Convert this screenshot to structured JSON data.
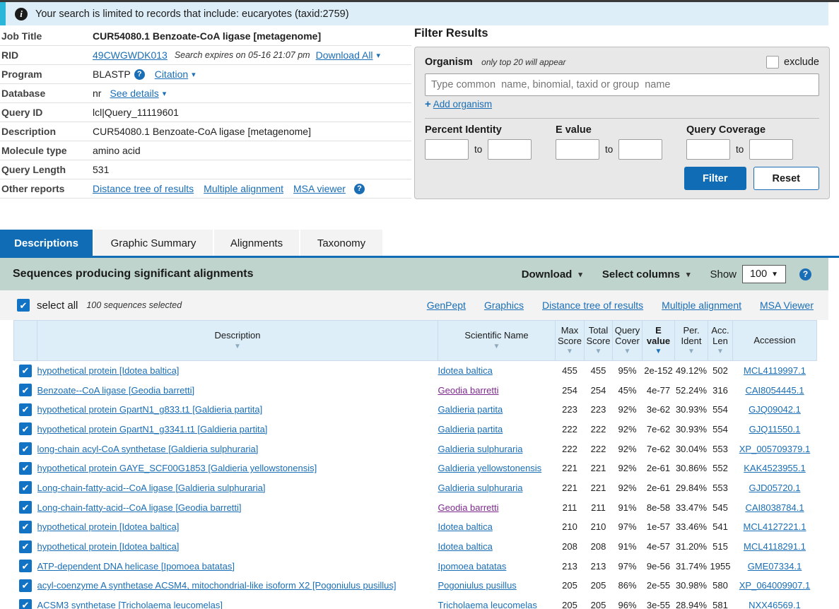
{
  "banner": {
    "icon": "info-icon",
    "text": "Your search is limited to records that include: eucaryotes (taxid:2759)"
  },
  "job_info": {
    "rows": [
      {
        "label": "Job Title",
        "value": "CUR54080.1 Benzoate-CoA ligase [metagenome]"
      },
      {
        "label": "RID",
        "link": "49CWGWDK013",
        "expires": "Search expires on 05-16 21:07 pm",
        "download_all": "Download All"
      },
      {
        "label": "Program",
        "value": "BLASTP",
        "citation": "Citation"
      },
      {
        "label": "Database",
        "value": "nr",
        "see_details": "See details"
      },
      {
        "label": "Query ID",
        "value": "lcl|Query_11119601"
      },
      {
        "label": "Description",
        "value": "CUR54080.1 Benzoate-CoA ligase [metagenome]"
      },
      {
        "label": "Molecule type",
        "value": "amino acid"
      },
      {
        "label": "Query Length",
        "value": "531"
      },
      {
        "label": "Other reports",
        "links": [
          "Distance tree of results",
          "Multiple alignment",
          "MSA viewer"
        ]
      }
    ]
  },
  "filter": {
    "title": "Filter Results",
    "organism_label": "Organism",
    "organism_hint": "only top 20 will appear",
    "exclude_label": "exclude",
    "organism_placeholder": "Type common  name, binomial, taxid or group  name",
    "organism_value": "",
    "add_organism": "Add organism",
    "percent_identity_label": "Percent Identity",
    "evalue_label": "E value",
    "query_coverage_label": "Query Coverage",
    "to_label": "to",
    "pid_from": "",
    "pid_to": "",
    "ev_from": "",
    "ev_to": "",
    "qc_from": "",
    "qc_to": "",
    "filter_button": "Filter",
    "reset_button": "Reset"
  },
  "tabs": [
    {
      "label": "Descriptions",
      "active": true
    },
    {
      "label": "Graphic Summary",
      "active": false
    },
    {
      "label": "Alignments",
      "active": false
    },
    {
      "label": "Taxonomy",
      "active": false
    }
  ],
  "results_band": {
    "title": "Sequences producing significant alignments",
    "download": "Download",
    "select_columns": "Select columns",
    "show_label": "Show",
    "show_value": "100",
    "help": "?"
  },
  "select_all": {
    "label": "select all",
    "count": "100 sequences selected",
    "links": [
      "GenPept",
      "Graphics",
      "Distance tree of results",
      "Multiple alignment",
      "MSA Viewer"
    ]
  },
  "table": {
    "columns": [
      {
        "key": "check",
        "label": ""
      },
      {
        "key": "description",
        "label": "Description",
        "sorted": false
      },
      {
        "key": "scientific_name",
        "label": "Scientific Name",
        "sorted": false
      },
      {
        "key": "max_score",
        "label": "Max\nScore",
        "line1": "Max",
        "line2": "Score",
        "sorted": false
      },
      {
        "key": "total_score",
        "label": "Total Score",
        "line1": "Total",
        "line2": "Score",
        "sorted": false
      },
      {
        "key": "query_cover",
        "label": "Query Cover",
        "line1": "Query",
        "line2": "Cover",
        "sorted": false
      },
      {
        "key": "e_value",
        "label": "E value",
        "line1": "E",
        "line2": "value",
        "sorted": true
      },
      {
        "key": "per_ident",
        "label": "Per. Ident",
        "line1": "Per.",
        "line2": "Ident",
        "sorted": false
      },
      {
        "key": "acc_len",
        "label": "Acc. Len",
        "line1": "Acc.",
        "line2": "Len",
        "sorted": false
      },
      {
        "key": "accession",
        "label": "Accession",
        "sorted": false
      }
    ],
    "rows": [
      {
        "checked": true,
        "description": "hypothetical protein [Idotea baltica]",
        "scientific_name": "Idotea baltica",
        "sci_visited": false,
        "max_score": "455",
        "total_score": "455",
        "query_cover": "95%",
        "e_value": "2e-152",
        "per_ident": "49.12%",
        "acc_len": "502",
        "accession": "MCL4119997.1"
      },
      {
        "checked": true,
        "description": "Benzoate--CoA ligase [Geodia barretti]",
        "scientific_name": "Geodia barretti",
        "sci_visited": true,
        "max_score": "254",
        "total_score": "254",
        "query_cover": "45%",
        "e_value": "4e-77",
        "per_ident": "52.24%",
        "acc_len": "316",
        "accession": "CAI8054445.1"
      },
      {
        "checked": true,
        "description": "hypothetical protein GpartN1_g833.t1 [Galdieria partita]",
        "scientific_name": "Galdieria partita",
        "sci_visited": false,
        "max_score": "223",
        "total_score": "223",
        "query_cover": "92%",
        "e_value": "3e-62",
        "per_ident": "30.93%",
        "acc_len": "554",
        "accession": "GJQ09042.1"
      },
      {
        "checked": true,
        "description": "hypothetical protein GpartN1_g3341.t1 [Galdieria partita]",
        "scientific_name": "Galdieria partita",
        "sci_visited": false,
        "max_score": "222",
        "total_score": "222",
        "query_cover": "92%",
        "e_value": "7e-62",
        "per_ident": "30.93%",
        "acc_len": "554",
        "accession": "GJQ11550.1"
      },
      {
        "checked": true,
        "description": "long-chain acyl-CoA synthetase [Galdieria sulphuraria]",
        "scientific_name": "Galdieria sulphuraria",
        "sci_visited": false,
        "max_score": "222",
        "total_score": "222",
        "query_cover": "92%",
        "e_value": "7e-62",
        "per_ident": "30.04%",
        "acc_len": "553",
        "accession": "XP_005709379.1"
      },
      {
        "checked": true,
        "description": "hypothetical protein GAYE_SCF00G1853 [Galdieria yellowstonensis]",
        "scientific_name": "Galdieria yellowstonensis",
        "sci_visited": false,
        "max_score": "221",
        "total_score": "221",
        "query_cover": "92%",
        "e_value": "2e-61",
        "per_ident": "30.86%",
        "acc_len": "552",
        "accession": "KAK4523955.1"
      },
      {
        "checked": true,
        "description": "Long-chain-fatty-acid--CoA ligase [Galdieria sulphuraria]",
        "scientific_name": "Galdieria sulphuraria",
        "sci_visited": false,
        "max_score": "221",
        "total_score": "221",
        "query_cover": "92%",
        "e_value": "2e-61",
        "per_ident": "29.84%",
        "acc_len": "553",
        "accession": "GJD05720.1"
      },
      {
        "checked": true,
        "description": "Long-chain-fatty-acid--CoA ligase [Geodia barretti]",
        "scientific_name": "Geodia barretti",
        "sci_visited": true,
        "max_score": "211",
        "total_score": "211",
        "query_cover": "91%",
        "e_value": "8e-58",
        "per_ident": "33.47%",
        "acc_len": "545",
        "accession": "CAI8038784.1"
      },
      {
        "checked": true,
        "description": "hypothetical protein [Idotea baltica]",
        "scientific_name": "Idotea baltica",
        "sci_visited": false,
        "max_score": "210",
        "total_score": "210",
        "query_cover": "97%",
        "e_value": "1e-57",
        "per_ident": "33.46%",
        "acc_len": "541",
        "accession": "MCL4127221.1"
      },
      {
        "checked": true,
        "description": "hypothetical protein [Idotea baltica]",
        "scientific_name": "Idotea baltica",
        "sci_visited": false,
        "max_score": "208",
        "total_score": "208",
        "query_cover": "91%",
        "e_value": "4e-57",
        "per_ident": "31.20%",
        "acc_len": "515",
        "accession": "MCL4118291.1"
      },
      {
        "checked": true,
        "description": "ATP-dependent DNA helicase [Ipomoea batatas]",
        "scientific_name": "Ipomoea batatas",
        "sci_visited": false,
        "max_score": "213",
        "total_score": "213",
        "query_cover": "97%",
        "e_value": "9e-56",
        "per_ident": "31.74%",
        "acc_len": "1955",
        "accession": "GME07334.1"
      },
      {
        "checked": true,
        "description": "acyl-coenzyme A synthetase ACSM4, mitochondrial-like isoform X2 [Pogoniulus pusillus]",
        "scientific_name": "Pogoniulus pusillus",
        "sci_visited": false,
        "max_score": "205",
        "total_score": "205",
        "query_cover": "86%",
        "e_value": "2e-55",
        "per_ident": "30.98%",
        "acc_len": "580",
        "accession": "XP_064009907.1"
      },
      {
        "checked": true,
        "description": "ACSM3 synthetase [Tricholaema leucomelas]",
        "scientific_name": "Tricholaema leucomelas",
        "sci_visited": false,
        "max_score": "205",
        "total_score": "205",
        "query_cover": "96%",
        "e_value": "3e-55",
        "per_ident": "28.94%",
        "acc_len": "581",
        "accession": "NXX46569.1"
      }
    ]
  },
  "colors": {
    "accent_blue": "#0f6cb5",
    "link_blue": "#1a6eb5",
    "banner_bg": "#deeef8",
    "banner_accent": "#29b6d8",
    "band_teal": "#bed4cd",
    "table_header_blue": "#ddeef8",
    "visited_link": "#7d2a8c"
  }
}
